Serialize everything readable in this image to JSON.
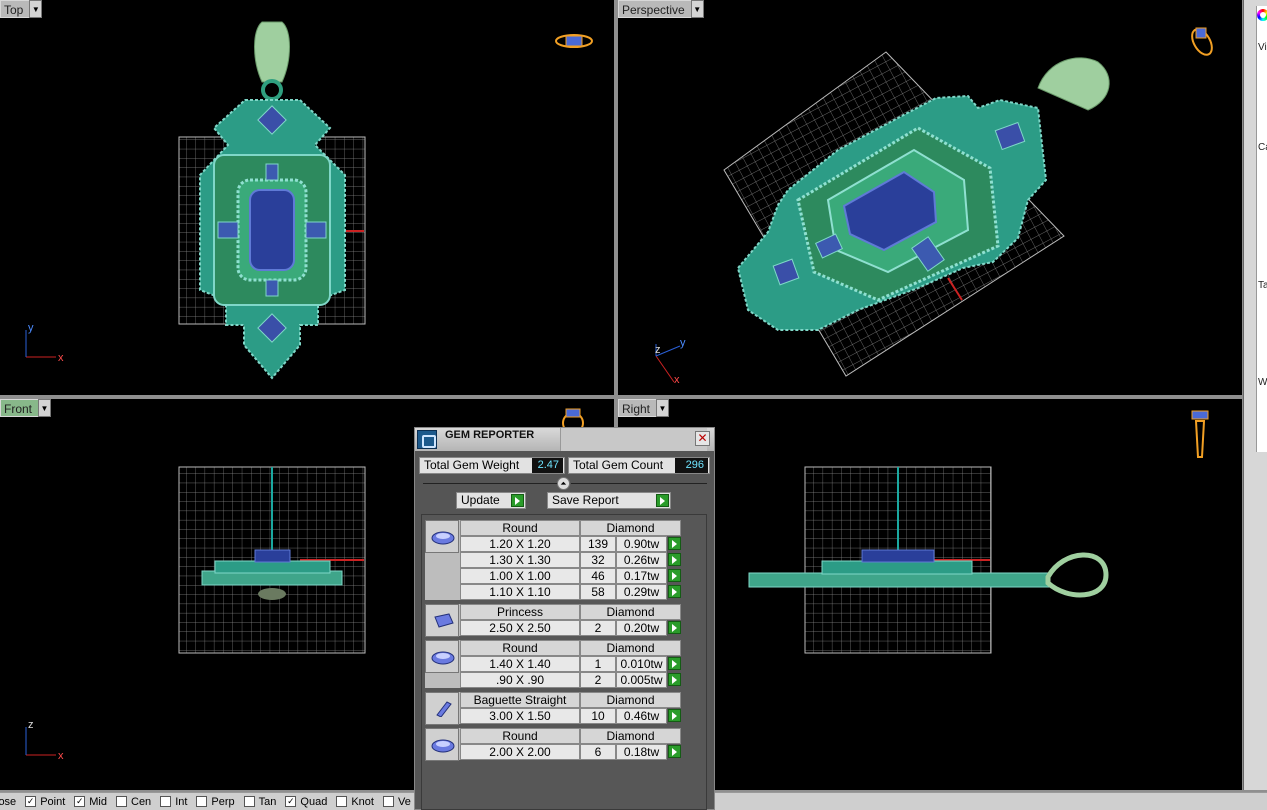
{
  "viewports": {
    "top": {
      "label": "Top"
    },
    "perspective": {
      "label": "Perspective"
    },
    "front": {
      "label": "Front"
    },
    "right": {
      "label": "Right"
    }
  },
  "axes": {
    "top": {
      "a": "y",
      "b": "x"
    },
    "perspective": {
      "a": "z",
      "b": "y",
      "c": "x"
    },
    "front": {
      "a": "z",
      "b": "x"
    }
  },
  "side_panel": {
    "letters": [
      "Vi",
      "Ca",
      "Ta",
      "W"
    ]
  },
  "status_bar": {
    "snaps": [
      {
        "label": "lose",
        "checked": false
      },
      {
        "label": "Point",
        "checked": true
      },
      {
        "label": "Mid",
        "checked": true
      },
      {
        "label": "Cen",
        "checked": false
      },
      {
        "label": "Int",
        "checked": false
      },
      {
        "label": "Perp",
        "checked": false
      },
      {
        "label": "Tan",
        "checked": false
      },
      {
        "label": "Quad",
        "checked": true
      },
      {
        "label": "Knot",
        "checked": false
      },
      {
        "label": "Ve",
        "checked": false
      }
    ]
  },
  "gem_reporter": {
    "title": "GEM REPORTER",
    "close_symbol": "✕",
    "total_weight_label": "Total Gem Weight",
    "total_weight_value": "2.47",
    "total_count_label": "Total Gem Count",
    "total_count_value": "296",
    "update_label": "Update",
    "save_label": "Save Report",
    "groups": [
      {
        "shape": "Round",
        "material": "Diamond",
        "icon": "round-gem-icon",
        "rows": [
          {
            "size": "1.20 X 1.20",
            "count": "139",
            "weight": "0.90tw"
          },
          {
            "size": "1.30 X 1.30",
            "count": "32",
            "weight": "0.26tw"
          },
          {
            "size": "1.00 X 1.00",
            "count": "46",
            "weight": "0.17tw"
          },
          {
            "size": "1.10 X 1.10",
            "count": "58",
            "weight": "0.29tw"
          }
        ]
      },
      {
        "shape": "Princess",
        "material": "Diamond",
        "icon": "princess-gem-icon",
        "rows": [
          {
            "size": "2.50 X 2.50",
            "count": "2",
            "weight": "0.20tw"
          }
        ]
      },
      {
        "shape": "Round",
        "material": "Diamond",
        "icon": "round-gem-icon",
        "rows": [
          {
            "size": "1.40 X 1.40",
            "count": "1",
            "weight": "0.010tw"
          },
          {
            "size": ".90 X .90",
            "count": "2",
            "weight": "0.005tw"
          }
        ]
      },
      {
        "shape": "Baguette Straight",
        "material": "Diamond",
        "icon": "baguette-gem-icon",
        "rows": [
          {
            "size": "3.00 X 1.50",
            "count": "10",
            "weight": "0.46tw"
          }
        ]
      },
      {
        "shape": "Round",
        "material": "Diamond",
        "icon": "round-gem-icon",
        "rows": [
          {
            "size": "2.00 X 2.00",
            "count": "6",
            "weight": "0.18tw"
          }
        ]
      }
    ]
  },
  "colors": {
    "metal": "#3fa58a",
    "gem_blue": "#2a3f9a",
    "stone_green": "#2e8a5c",
    "grid": "#9a9a9a",
    "accent_go": "#2a9c2a",
    "value_text": "#6ee4ff"
  }
}
